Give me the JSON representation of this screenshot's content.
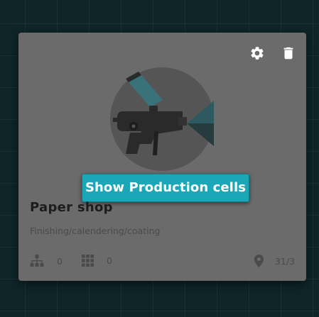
{
  "card": {
    "title": "Paper shop",
    "subtitle": "Finishing/calendering/coating",
    "cta_label": "Show Production cells",
    "hierarchy_count": "0",
    "cells_count": "0",
    "location": "31/3",
    "icons": {
      "settings": "gear-icon",
      "delete": "trash-icon",
      "hero": "spray-gun-icon",
      "hierarchy": "hierarchy-icon",
      "grid": "grid-icon",
      "location": "location-pin-icon"
    }
  },
  "colors": {
    "background": "#0f2528",
    "card": "#6b6b6b",
    "accent": "#1aa7b8",
    "hero_circle": "#555555",
    "hero_cup": "#2c5a60"
  }
}
